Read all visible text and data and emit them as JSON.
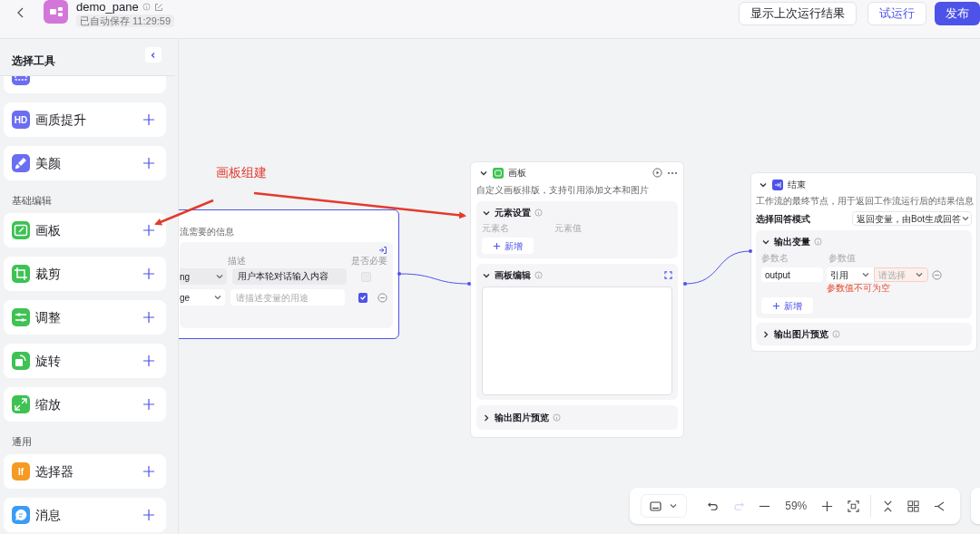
{
  "header": {
    "title": "demo_pane",
    "save_status": "已自动保存 11:29:59",
    "buttons": [
      {
        "label": "显示上次运行结果",
        "kind": "outline"
      },
      {
        "label": "试运行",
        "kind": "secondary"
      },
      {
        "label": "发布",
        "kind": "primary"
      }
    ]
  },
  "sidebar": {
    "title": "选择工具",
    "items": [
      {
        "kind": "partial",
        "color": "#6b6ef0"
      },
      {
        "kind": "tool",
        "label": "画质提升",
        "badge": "HD",
        "color": "#6b6ef0"
      },
      {
        "kind": "tool",
        "label": "美颜",
        "color": "#6b6ef0"
      },
      {
        "kind": "heading",
        "label": "基础编辑"
      },
      {
        "kind": "tool",
        "label": "画板",
        "color": "#3ec254"
      },
      {
        "kind": "tool",
        "label": "裁剪",
        "color": "#3ec254"
      },
      {
        "kind": "tool",
        "label": "调整",
        "color": "#3ec254"
      },
      {
        "kind": "tool",
        "label": "旋转",
        "color": "#3ec254"
      },
      {
        "kind": "tool",
        "label": "缩放",
        "color": "#3ec254"
      },
      {
        "kind": "heading",
        "label": "通用"
      },
      {
        "kind": "tool",
        "label": "选择器",
        "badge": "If",
        "color": "#f59a23"
      },
      {
        "kind": "tool",
        "label": "消息",
        "color": "#3b9cf5"
      }
    ]
  },
  "annotation": {
    "label": "画板组建"
  },
  "start_node": {
    "selected": true,
    "description": "流需要的信息",
    "columns": [
      "描述",
      "是否必要"
    ],
    "rows": [
      {
        "type": "ng",
        "description": "用户本轮对话输入内容",
        "required": false,
        "locked": true
      },
      {
        "type": "ge",
        "placeholder": "请描述变量的用途",
        "required": true,
        "locked": false
      }
    ]
  },
  "board_node": {
    "selected": false,
    "title": "画板",
    "description": "自定义画板排版，支持引用添加文本和图片",
    "sections": [
      {
        "kind": "elements",
        "title": "元素设置",
        "expanded": true,
        "columns": [
          "元素名",
          "元素值"
        ],
        "add": "新增"
      },
      {
        "kind": "editor",
        "title": "画板编辑",
        "expanded": true
      },
      {
        "kind": "preview",
        "title": "输出图片预览",
        "expanded": false
      }
    ]
  },
  "end_node": {
    "selected": false,
    "title": "结束",
    "description": "工作流的最终节点，用于返回工作流运行后的结果信息",
    "mode_label": "选择回答模式",
    "mode": "返回变量，由Bot生成回答",
    "output": {
      "title": "输出变量",
      "expanded": true,
      "columns": [
        "参数名",
        "参数值"
      ],
      "name": "output",
      "source": "引用",
      "value_placeholder": "请选择",
      "error": "参数值不可为空",
      "add": "新增"
    },
    "preview": {
      "title": "输出图片预览",
      "expanded": false
    }
  },
  "toolbar": {
    "zoom": "59%",
    "redo_disabled": true
  }
}
